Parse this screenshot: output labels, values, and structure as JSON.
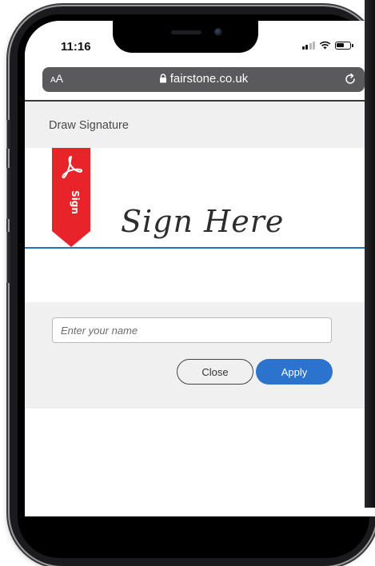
{
  "status_bar": {
    "time": "11:16"
  },
  "browser": {
    "text_size_label_small": "A",
    "text_size_label_large": "A",
    "url": "fairstone.co.uk",
    "lock_icon": "lock-icon",
    "reload_icon": "reload-icon"
  },
  "dialog": {
    "title": "Draw Signature",
    "ribbon_label": "Sign",
    "sign_here": "Sign Here",
    "name_placeholder": "Enter your name",
    "close_label": "Close",
    "apply_label": "Apply"
  },
  "colors": {
    "ribbon": "#e8232a",
    "signature_line": "#2b6fc0",
    "apply_button": "#2b73cc",
    "panel_bg": "#f0f0f0",
    "fab": "#3d3a63"
  }
}
